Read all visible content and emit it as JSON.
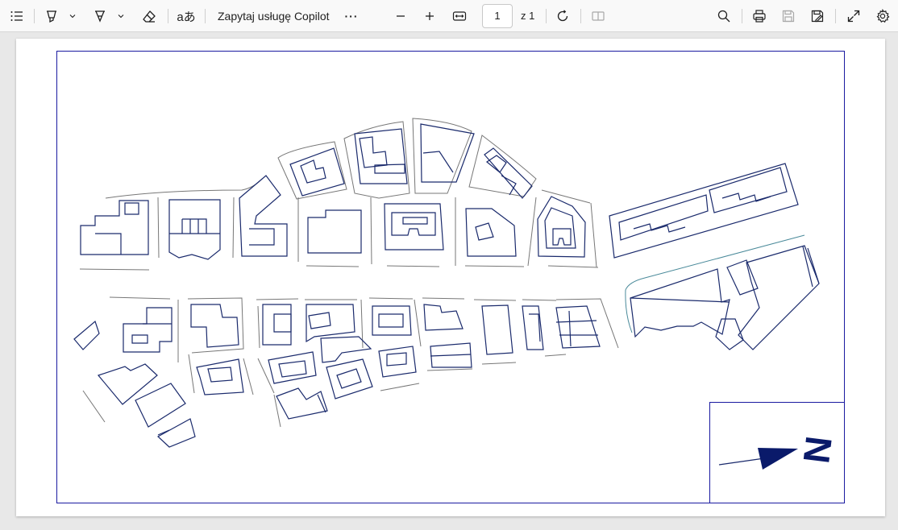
{
  "toolbar": {
    "copilot_label": "Zapytaj usługę Copilot",
    "more_label": "···",
    "page_current": "1",
    "page_of": "z 1",
    "icons": [
      "contents-icon",
      "highlighter-icon",
      "chevron-down-icon",
      "draw-icon",
      "chevron-down-icon",
      "eraser-icon",
      "read-aloud-icon",
      "zoom-out-icon",
      "zoom-in-icon",
      "fit-width-icon",
      "rotate-icon",
      "page-view-icon",
      "search-icon",
      "print-icon",
      "save-icon",
      "save-as-icon",
      "fullscreen-icon",
      "settings-icon"
    ]
  },
  "document": {
    "north_label": "N",
    "frame_color": "#1a1aa0",
    "building_color": "#1a2a6c",
    "road_color": "#777777"
  }
}
